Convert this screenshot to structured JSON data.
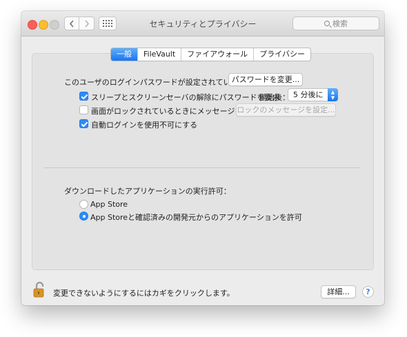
{
  "window": {
    "title": "セキュリティとプライバシー",
    "search_placeholder": "検索"
  },
  "icons": {
    "back": "chevron-left-icon",
    "forward": "chevron-right-icon",
    "show_all": "grid-icon",
    "search": "search-icon",
    "lock": "lock-open-icon",
    "help": "help-icon"
  },
  "tabs": [
    {
      "label": "一般",
      "active": true
    },
    {
      "label": "FileVault",
      "active": false
    },
    {
      "label": "ファイアウォール",
      "active": false
    },
    {
      "label": "プライバシー",
      "active": false
    }
  ],
  "general": {
    "password_set_text": "このユーザのログインパスワードが設定されています",
    "change_password_label": "パスワードを変更...",
    "require_password": {
      "label": "スリープとスクリーンセーバの解除にパスワードを要求",
      "checked": true
    },
    "delay_label": "開始後：",
    "delay_value": "5 分後に",
    "show_message": {
      "label": "画面がロックされているときにメッセージを表示",
      "checked": false
    },
    "set_message_label": "ロックのメッセージを設定...",
    "disable_autologin": {
      "label": "自動ログインを使用不可にする",
      "checked": true
    },
    "downloads_heading": "ダウンロードしたアプリケーションの実行許可：",
    "option_app_store": {
      "label": "App Store",
      "selected": false
    },
    "option_identified": {
      "label": "App Storeと確認済みの開発元からのアプリケーションを許可",
      "selected": true
    }
  },
  "footer": {
    "lock_text": "変更できないようにするにはカギをクリックします。",
    "advanced_label": "詳細...",
    "help_label": "?"
  },
  "colors": {
    "accent": "#2d8cf7",
    "window_bg": "#ececec",
    "panel_bg": "#e3e3e3",
    "lock_gold": "#d7932b"
  }
}
